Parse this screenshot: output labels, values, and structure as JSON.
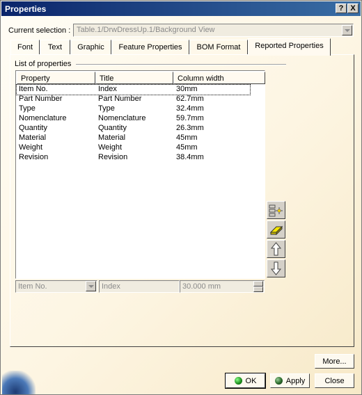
{
  "window": {
    "title": "Properties",
    "help_label": "?",
    "close_label": "X"
  },
  "selection": {
    "label": "Current selection :",
    "value": "Table.1/DrwDressUp.1/Background View"
  },
  "tabs": [
    {
      "label": "Font"
    },
    {
      "label": "Text"
    },
    {
      "label": "Graphic"
    },
    {
      "label": "Feature Properties"
    },
    {
      "label": "BOM Format"
    },
    {
      "label": "Reported Properties",
      "active": true
    }
  ],
  "properties": {
    "group_label": "List of properties",
    "columns": [
      "Property",
      "Title",
      "Column width"
    ],
    "rows": [
      [
        "Item No.",
        "Index",
        "30mm"
      ],
      [
        "Part Number",
        "Part Number",
        "62.7mm"
      ],
      [
        "Type",
        "Type",
        "32.4mm"
      ],
      [
        "Nomenclature",
        "Nomenclature",
        "59.7mm"
      ],
      [
        "Quantity",
        "Quantity",
        "26.3mm"
      ],
      [
        "Material",
        "Material",
        "45mm"
      ],
      [
        "Weight",
        "Weight",
        "45mm"
      ],
      [
        "Revision",
        "Revision",
        "38.4mm"
      ]
    ],
    "selected_row": 0
  },
  "editor": {
    "property_value": "Item No.",
    "title_value": "Index",
    "width_value": "30.000 mm"
  },
  "side_buttons": [
    "add-property-icon",
    "eraser-icon",
    "up-arrow-icon",
    "down-arrow-icon"
  ],
  "buttons": {
    "more": "More...",
    "ok": "OK",
    "apply": "Apply",
    "close": "Close"
  },
  "colors": {
    "title_bar_start": "#0a246a",
    "title_bar_end": "#3a6ea5",
    "ok_icon": "#1a8a1a"
  }
}
